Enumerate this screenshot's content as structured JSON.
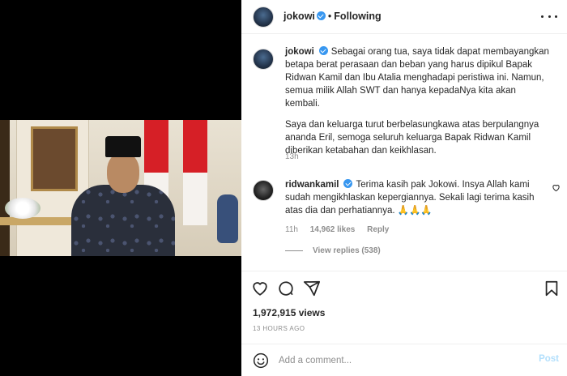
{
  "header": {
    "username": "jokowi",
    "separator": "•",
    "follow_status": "Following"
  },
  "caption": {
    "username": "jokowi",
    "paragraphs": [
      "Sebagai orang tua, saya tidak dapat membayangkan betapa berat perasaan dan beban yang harus dipikul Bapak Ridwan Kamil dan Ibu Atalia menghadapi peristiwa ini. Namun, semua milik Allah SWT dan hanya kepadaNya kita akan kembali.",
      "Saya dan keluarga turut berbelasungkawa atas berpulangnya ananda Eril, semoga seluruh keluarga Bapak Ridwan Kamil diberikan ketabahan dan keikhlasan."
    ],
    "time": "13h"
  },
  "reply": {
    "username": "ridwankamil",
    "text": "Terima kasih pak Jokowi. Insya Allah kami sudah mengikhlaskan kepergiannya. Sekali lagi terima kasih atas dia dan perhatiannya. 🙏🙏🙏",
    "time": "11h",
    "likes": "14,962 likes",
    "reply_label": "Reply",
    "view_replies": "View replies (538)"
  },
  "actions": {
    "views": "1,972,915 views",
    "ago": "13 HOURS AGO"
  },
  "add_comment": {
    "placeholder": "Add a comment...",
    "post_label": "Post"
  },
  "icons": [
    "heart-icon",
    "comment-icon",
    "share-icon",
    "bookmark-icon",
    "emoji-icon",
    "more-icon",
    "verified-badge-icon"
  ],
  "colors": {
    "verified": "#3897f0",
    "post_button": "#b2dffc",
    "muted_text": "#8e8e8e"
  }
}
